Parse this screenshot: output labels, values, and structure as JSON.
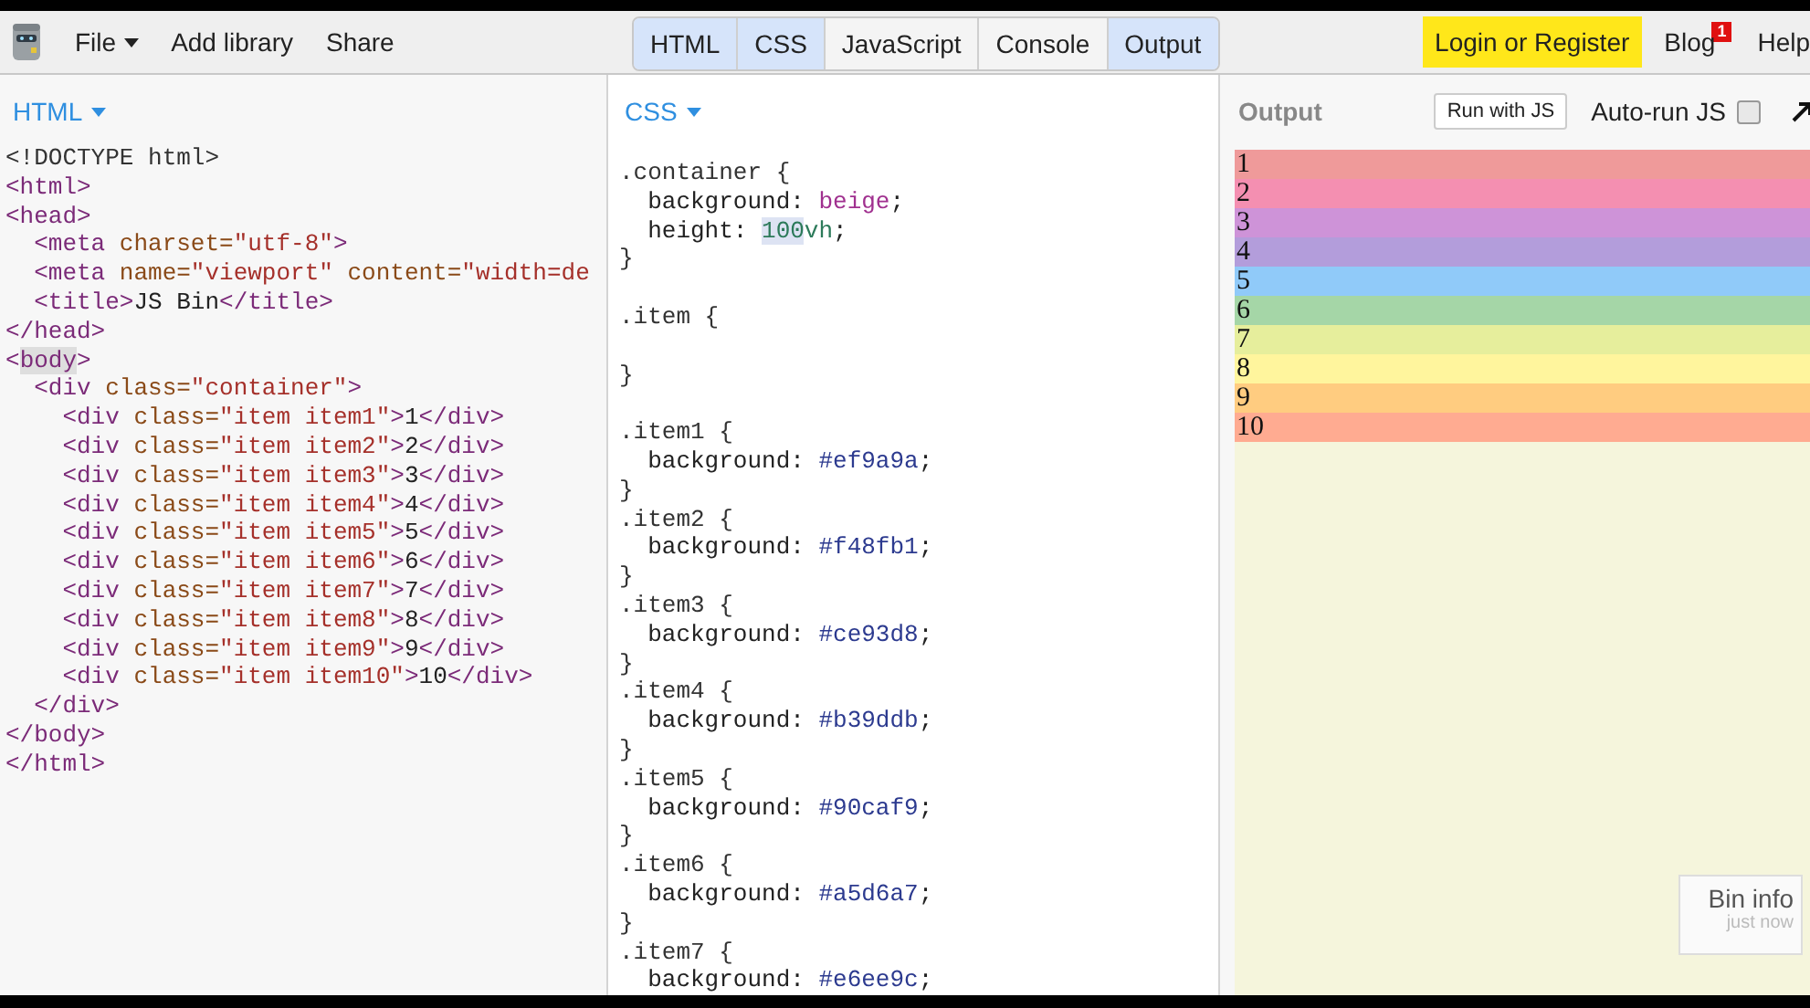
{
  "toolbar": {
    "menu": [
      {
        "label": "File",
        "dropdown": true
      },
      {
        "label": "Add library",
        "dropdown": false
      },
      {
        "label": "Share",
        "dropdown": false
      }
    ],
    "panel_tabs": [
      {
        "label": "HTML",
        "selected": true
      },
      {
        "label": "CSS",
        "selected": true
      },
      {
        "label": "JavaScript",
        "selected": false
      },
      {
        "label": "Console",
        "selected": false
      },
      {
        "label": "Output",
        "selected": true
      }
    ],
    "login_button": "Login or Register",
    "blog": {
      "label": "Blog",
      "badge": "1"
    },
    "help": "Help"
  },
  "html_panel": {
    "title": "HTML",
    "lines": [
      {
        "kind": "code",
        "tokens": [
          {
            "kind": "doctype",
            "text": "<!DOCTYPE html>"
          }
        ]
      },
      {
        "kind": "code",
        "tokens": [
          {
            "kind": "tag",
            "text": "<html>"
          }
        ]
      },
      {
        "kind": "code",
        "tokens": [
          {
            "kind": "tag",
            "text": "<head>"
          }
        ]
      },
      {
        "kind": "code",
        "tokens": [
          {
            "kind": "tag",
            "text": "  <meta"
          },
          {
            "kind": "attr",
            "text": " charset="
          },
          {
            "kind": "str",
            "text": "\"utf-8\""
          },
          {
            "kind": "tag",
            "text": ">"
          }
        ]
      },
      {
        "kind": "code",
        "tokens": [
          {
            "kind": "tag",
            "text": "  <meta"
          },
          {
            "kind": "attr",
            "text": " name="
          },
          {
            "kind": "str",
            "text": "\"viewport\""
          },
          {
            "kind": "attr",
            "text": " content="
          },
          {
            "kind": "str",
            "text": "\"width=de"
          }
        ]
      },
      {
        "kind": "code",
        "tokens": [
          {
            "kind": "tag",
            "text": "  <title>"
          },
          {
            "kind": "text",
            "text": "JS Bin"
          },
          {
            "kind": "tag",
            "text": "</title>"
          }
        ]
      },
      {
        "kind": "code",
        "tokens": [
          {
            "kind": "tag",
            "text": "</head>"
          }
        ]
      },
      {
        "kind": "code",
        "tokens": [
          {
            "kind": "tag",
            "text": "<"
          },
          {
            "kind": "tag-hl",
            "text": "body"
          },
          {
            "kind": "tag",
            "text": ">"
          }
        ]
      },
      {
        "kind": "code",
        "tokens": [
          {
            "kind": "tag",
            "text": "  <div"
          },
          {
            "kind": "attr",
            "text": " class="
          },
          {
            "kind": "str",
            "text": "\"container\""
          },
          {
            "kind": "tag",
            "text": ">"
          }
        ]
      },
      {
        "kind": "code",
        "tokens": [
          {
            "kind": "tag",
            "text": "    <div"
          },
          {
            "kind": "attr",
            "text": " class="
          },
          {
            "kind": "str",
            "text": "\"item item1\""
          },
          {
            "kind": "tag",
            "text": ">"
          },
          {
            "kind": "text",
            "text": "1"
          },
          {
            "kind": "tag",
            "text": "</div>"
          }
        ]
      },
      {
        "kind": "code",
        "tokens": [
          {
            "kind": "tag",
            "text": "    <div"
          },
          {
            "kind": "attr",
            "text": " class="
          },
          {
            "kind": "str",
            "text": "\"item item2\""
          },
          {
            "kind": "tag",
            "text": ">"
          },
          {
            "kind": "text",
            "text": "2"
          },
          {
            "kind": "tag",
            "text": "</div>"
          }
        ]
      },
      {
        "kind": "code",
        "tokens": [
          {
            "kind": "tag",
            "text": "    <div"
          },
          {
            "kind": "attr",
            "text": " class="
          },
          {
            "kind": "str",
            "text": "\"item item3\""
          },
          {
            "kind": "tag",
            "text": ">"
          },
          {
            "kind": "text",
            "text": "3"
          },
          {
            "kind": "tag",
            "text": "</div>"
          }
        ]
      },
      {
        "kind": "code",
        "tokens": [
          {
            "kind": "tag",
            "text": "    <div"
          },
          {
            "kind": "attr",
            "text": " class="
          },
          {
            "kind": "str",
            "text": "\"item item4\""
          },
          {
            "kind": "tag",
            "text": ">"
          },
          {
            "kind": "text",
            "text": "4"
          },
          {
            "kind": "tag",
            "text": "</div>"
          }
        ]
      },
      {
        "kind": "code",
        "tokens": [
          {
            "kind": "tag",
            "text": "    <div"
          },
          {
            "kind": "attr",
            "text": " class="
          },
          {
            "kind": "str",
            "text": "\"item item5\""
          },
          {
            "kind": "tag",
            "text": ">"
          },
          {
            "kind": "text",
            "text": "5"
          },
          {
            "kind": "tag",
            "text": "</div>"
          }
        ]
      },
      {
        "kind": "code",
        "tokens": [
          {
            "kind": "tag",
            "text": "    <div"
          },
          {
            "kind": "attr",
            "text": " class="
          },
          {
            "kind": "str",
            "text": "\"item item6\""
          },
          {
            "kind": "tag",
            "text": ">"
          },
          {
            "kind": "text",
            "text": "6"
          },
          {
            "kind": "tag",
            "text": "</div>"
          }
        ]
      },
      {
        "kind": "code",
        "tokens": [
          {
            "kind": "tag",
            "text": "    <div"
          },
          {
            "kind": "attr",
            "text": " class="
          },
          {
            "kind": "str",
            "text": "\"item item7\""
          },
          {
            "kind": "tag",
            "text": ">"
          },
          {
            "kind": "text",
            "text": "7"
          },
          {
            "kind": "tag",
            "text": "</div>"
          }
        ]
      },
      {
        "kind": "code",
        "tokens": [
          {
            "kind": "tag",
            "text": "    <div"
          },
          {
            "kind": "attr",
            "text": " class="
          },
          {
            "kind": "str",
            "text": "\"item item8\""
          },
          {
            "kind": "tag",
            "text": ">"
          },
          {
            "kind": "text",
            "text": "8"
          },
          {
            "kind": "tag",
            "text": "</div>"
          }
        ]
      },
      {
        "kind": "code",
        "tokens": [
          {
            "kind": "tag",
            "text": "    <div"
          },
          {
            "kind": "attr",
            "text": " class="
          },
          {
            "kind": "str",
            "text": "\"item item9\""
          },
          {
            "kind": "tag",
            "text": ">"
          },
          {
            "kind": "text",
            "text": "9"
          },
          {
            "kind": "tag",
            "text": "</div>"
          }
        ]
      },
      {
        "kind": "code",
        "tokens": [
          {
            "kind": "tag",
            "text": "    <div"
          },
          {
            "kind": "attr",
            "text": " class="
          },
          {
            "kind": "str",
            "text": "\"item item10\""
          },
          {
            "kind": "tag",
            "text": ">"
          },
          {
            "kind": "text",
            "text": "10"
          },
          {
            "kind": "tag",
            "text": "</div>"
          }
        ]
      },
      {
        "kind": "code",
        "tokens": [
          {
            "kind": "tag",
            "text": "  </div>"
          }
        ]
      },
      {
        "kind": "code",
        "tokens": [
          {
            "kind": "tag",
            "text": "</body>"
          }
        ]
      },
      {
        "kind": "code",
        "tokens": [
          {
            "kind": "tag",
            "text": "</html>"
          }
        ]
      }
    ]
  },
  "css_panel": {
    "title": "CSS",
    "lines": [
      {
        "kind": "code",
        "tokens": [
          {
            "kind": "sel",
            "text": ".container {"
          }
        ]
      },
      {
        "kind": "code",
        "tokens": [
          {
            "kind": "prop",
            "text": "  background: "
          },
          {
            "kind": "kw",
            "text": "beige"
          },
          {
            "kind": "prop",
            "text": ";"
          }
        ]
      },
      {
        "kind": "code",
        "tokens": [
          {
            "kind": "prop",
            "text": "  height: "
          },
          {
            "kind": "num-hl",
            "text": "100"
          },
          {
            "kind": "num",
            "text": "vh"
          },
          {
            "kind": "prop",
            "text": ";"
          }
        ]
      },
      {
        "kind": "code",
        "tokens": [
          {
            "kind": "sel",
            "text": "}"
          }
        ]
      },
      {
        "kind": "blank"
      },
      {
        "kind": "code",
        "tokens": [
          {
            "kind": "sel",
            "text": ".item {"
          }
        ]
      },
      {
        "kind": "blank"
      },
      {
        "kind": "code",
        "tokens": [
          {
            "kind": "sel",
            "text": "}"
          }
        ]
      },
      {
        "kind": "blank"
      },
      {
        "kind": "code",
        "tokens": [
          {
            "kind": "sel",
            "text": ".item1 {"
          }
        ]
      },
      {
        "kind": "code",
        "tokens": [
          {
            "kind": "prop",
            "text": "  background: "
          },
          {
            "kind": "hex",
            "text": "#ef9a9a"
          },
          {
            "kind": "prop",
            "text": ";"
          }
        ]
      },
      {
        "kind": "code",
        "tokens": [
          {
            "kind": "sel",
            "text": "}"
          }
        ]
      },
      {
        "kind": "code",
        "tokens": [
          {
            "kind": "sel",
            "text": ".item2 {"
          }
        ]
      },
      {
        "kind": "code",
        "tokens": [
          {
            "kind": "prop",
            "text": "  background: "
          },
          {
            "kind": "hex",
            "text": "#f48fb1"
          },
          {
            "kind": "prop",
            "text": ";"
          }
        ]
      },
      {
        "kind": "code",
        "tokens": [
          {
            "kind": "sel",
            "text": "}"
          }
        ]
      },
      {
        "kind": "code",
        "tokens": [
          {
            "kind": "sel",
            "text": ".item3 {"
          }
        ]
      },
      {
        "kind": "code",
        "tokens": [
          {
            "kind": "prop",
            "text": "  background: "
          },
          {
            "kind": "hex",
            "text": "#ce93d8"
          },
          {
            "kind": "prop",
            "text": ";"
          }
        ]
      },
      {
        "kind": "code",
        "tokens": [
          {
            "kind": "sel",
            "text": "}"
          }
        ]
      },
      {
        "kind": "code",
        "tokens": [
          {
            "kind": "sel",
            "text": ".item4 {"
          }
        ]
      },
      {
        "kind": "code",
        "tokens": [
          {
            "kind": "prop",
            "text": "  background: "
          },
          {
            "kind": "hex",
            "text": "#b39ddb"
          },
          {
            "kind": "prop",
            "text": ";"
          }
        ]
      },
      {
        "kind": "code",
        "tokens": [
          {
            "kind": "sel",
            "text": "}"
          }
        ]
      },
      {
        "kind": "code",
        "tokens": [
          {
            "kind": "sel",
            "text": ".item5 {"
          }
        ]
      },
      {
        "kind": "code",
        "tokens": [
          {
            "kind": "prop",
            "text": "  background: "
          },
          {
            "kind": "hex",
            "text": "#90caf9"
          },
          {
            "kind": "prop",
            "text": ";"
          }
        ]
      },
      {
        "kind": "code",
        "tokens": [
          {
            "kind": "sel",
            "text": "}"
          }
        ]
      },
      {
        "kind": "code",
        "tokens": [
          {
            "kind": "sel",
            "text": ".item6 {"
          }
        ]
      },
      {
        "kind": "code",
        "tokens": [
          {
            "kind": "prop",
            "text": "  background: "
          },
          {
            "kind": "hex",
            "text": "#a5d6a7"
          },
          {
            "kind": "prop",
            "text": ";"
          }
        ]
      },
      {
        "kind": "code",
        "tokens": [
          {
            "kind": "sel",
            "text": "}"
          }
        ]
      },
      {
        "kind": "code",
        "tokens": [
          {
            "kind": "sel",
            "text": ".item7 {"
          }
        ]
      },
      {
        "kind": "code",
        "tokens": [
          {
            "kind": "prop",
            "text": "  background: "
          },
          {
            "kind": "hex",
            "text": "#e6ee9c"
          },
          {
            "kind": "prop",
            "text": ";"
          }
        ]
      }
    ]
  },
  "output_panel": {
    "title": "Output",
    "run_button": "Run with JS",
    "autorun": {
      "label": "Auto-run JS",
      "checked": false
    },
    "items": [
      {
        "label": "1",
        "color": "#ef9a9a"
      },
      {
        "label": "2",
        "color": "#f48fb1"
      },
      {
        "label": "3",
        "color": "#ce93d8"
      },
      {
        "label": "4",
        "color": "#b39ddb"
      },
      {
        "label": "5",
        "color": "#90caf9"
      },
      {
        "label": "6",
        "color": "#a5d6a7"
      },
      {
        "label": "7",
        "color": "#e6ee9c"
      },
      {
        "label": "8",
        "color": "#fff59d"
      },
      {
        "label": "9",
        "color": "#ffcc80"
      },
      {
        "label": "10",
        "color": "#ffab91"
      }
    ],
    "bin_info": {
      "title": "Bin info",
      "time": "just now"
    }
  }
}
